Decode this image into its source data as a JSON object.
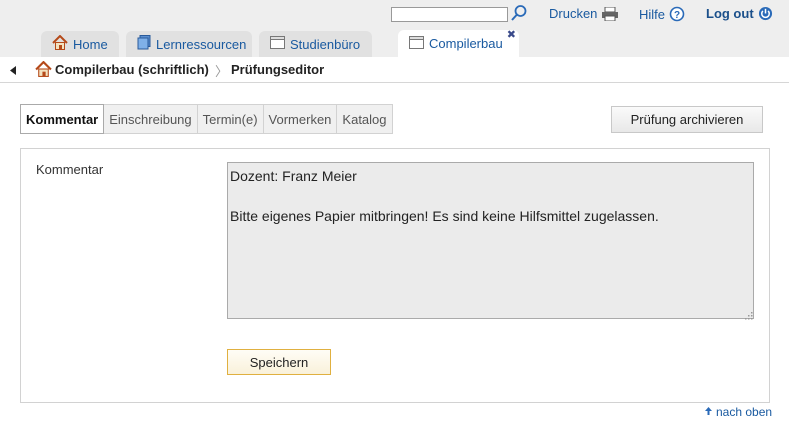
{
  "header": {
    "search": {
      "value": "",
      "placeholder": ""
    },
    "print_label": "Drucken",
    "help_label": "Hilfe",
    "logout_label": "Log out"
  },
  "tabs": [
    {
      "label": "Home",
      "icon": "home-icon"
    },
    {
      "label": "Lernressourcen",
      "icon": "books-icon"
    },
    {
      "label": "Studienbüro",
      "icon": "window-icon"
    },
    {
      "label": "Compilerbau",
      "icon": "window-icon",
      "active": true
    }
  ],
  "breadcrumb": {
    "items": [
      "Compilerbau (schriftlich)",
      "Prüfungseditor"
    ]
  },
  "subtabs": [
    {
      "label": "Kommentar",
      "active": true
    },
    {
      "label": "Einschreibung"
    },
    {
      "label": "Termin(e)"
    },
    {
      "label": "Vormerken"
    },
    {
      "label": "Katalog"
    }
  ],
  "archive_label": "Prüfung archivieren",
  "form": {
    "comment_label": "Kommentar",
    "comment_value": "Dozent: Franz Meier\n\nBitte eigenes Papier mitbringen! Es sind keine Hilfsmittel zugelassen.",
    "save_label": "Speichern"
  },
  "footer": {
    "to_top_label": "nach oben"
  },
  "colors": {
    "link": "#1a5aa0",
    "save_border": "#e0b040",
    "header_bg": "#eeeeee"
  }
}
